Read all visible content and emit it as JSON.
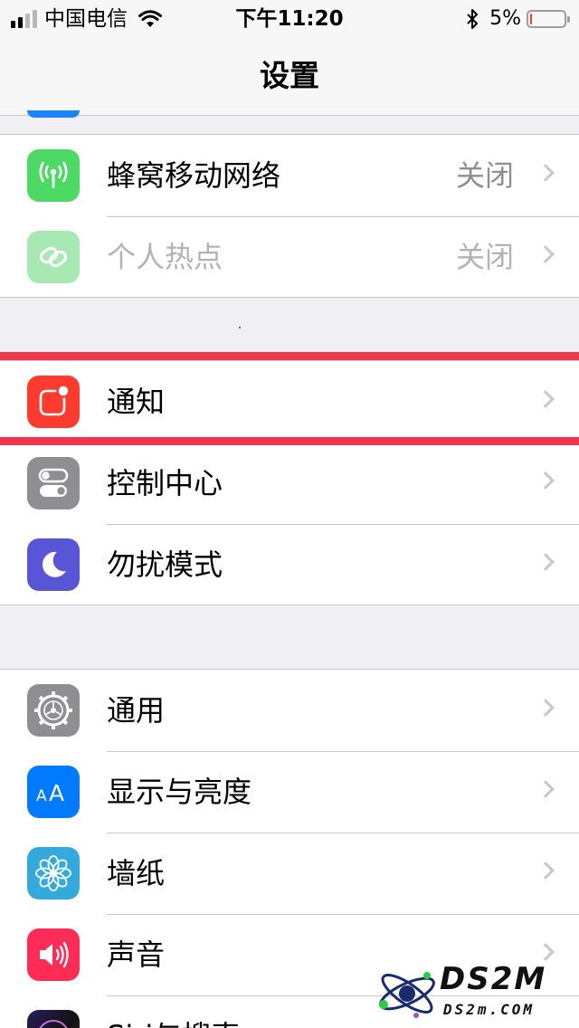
{
  "status_bar": {
    "carrier": "中国电信",
    "time": "下午11:20",
    "battery_percent": "5%",
    "battery_level": 0.05
  },
  "nav": {
    "title": "设置"
  },
  "groups": [
    {
      "rows": [
        {
          "label": "蜂窝移动网络",
          "value": "关闭",
          "icon": "antenna-icon",
          "icon_color": "#4cd964"
        },
        {
          "label": "个人热点",
          "value": "关闭",
          "icon": "chain-link-icon",
          "icon_color": "#4cd964",
          "disabled": true
        }
      ]
    },
    {
      "rows": [
        {
          "label": "通知",
          "icon": "notification-badge-icon",
          "icon_color": "#ff3b30"
        },
        {
          "label": "控制中心",
          "icon": "toggles-icon",
          "icon_color": "#8e8e93"
        },
        {
          "label": "勿扰模式",
          "icon": "moon-icon",
          "icon_color": "#5856d6"
        }
      ]
    },
    {
      "rows": [
        {
          "label": "通用",
          "icon": "gear-icon",
          "icon_color": "#8e8e93"
        },
        {
          "label": "显示与亮度",
          "icon": "text-size-icon",
          "icon_color": "#007aff"
        },
        {
          "label": "墙纸",
          "icon": "flower-icon",
          "icon_color": "#34aadc"
        },
        {
          "label": "声音",
          "icon": "speaker-icon",
          "icon_color": "#ff2d55"
        },
        {
          "label": "Siri与搜索",
          "icon": "siri-icon",
          "icon_color": "#1c1c3a"
        }
      ]
    }
  ],
  "highlight_color": "#f0364c",
  "watermark": {
    "brand": "DS2M",
    "domain": "DS2m.COM"
  }
}
